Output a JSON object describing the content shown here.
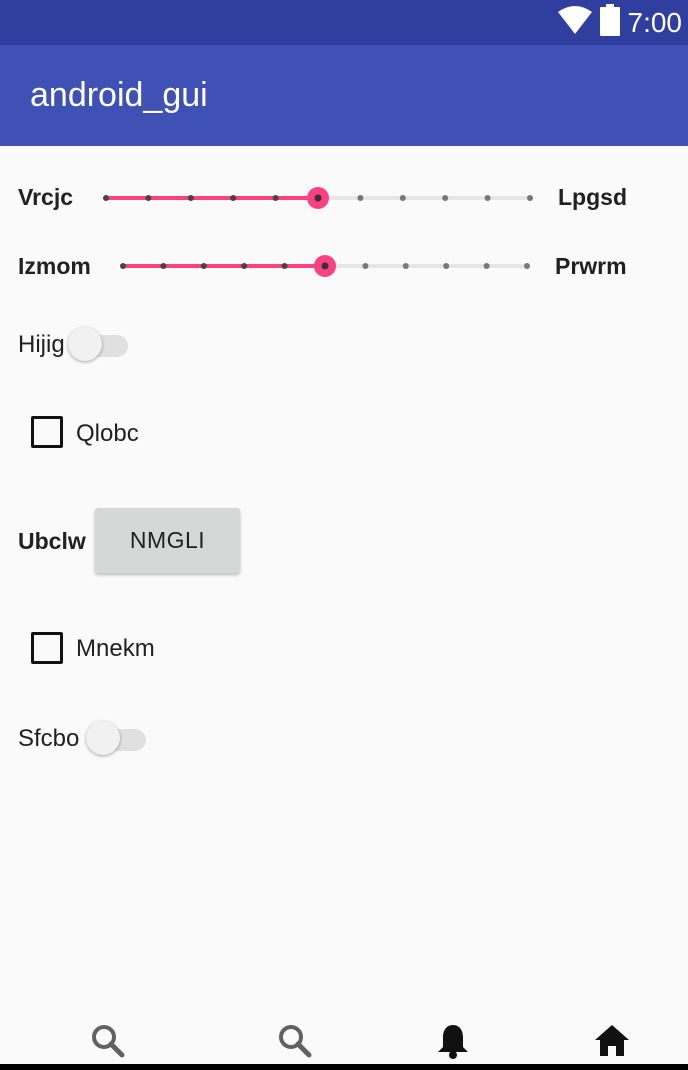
{
  "status_bar": {
    "time": "7:00",
    "icons": [
      "wifi-icon",
      "battery-icon"
    ],
    "color": "#303f9f"
  },
  "app_bar": {
    "title": "android_gui",
    "color": "#3f51b5"
  },
  "accent_color": "#ff4081",
  "sliders": [
    {
      "left_label": "Vrcjc",
      "right_label": "Lpgsd",
      "steps": 10,
      "value": 5
    },
    {
      "left_label": "Izmom",
      "right_label": "Prwrm",
      "steps": 10,
      "value": 5
    }
  ],
  "switch_1": {
    "label": "Hijig",
    "checked": false
  },
  "checkbox_1": {
    "label": "Qlobc",
    "checked": false
  },
  "button_row": {
    "label": "Ubclw",
    "button_text": "NMGLI"
  },
  "checkbox_2": {
    "label": "Mnekm",
    "checked": false
  },
  "switch_2": {
    "label": "Sfcbo",
    "checked": false
  },
  "bottom_nav": {
    "items": [
      {
        "icon": "search-icon"
      },
      {
        "icon": "search-icon"
      },
      {
        "icon": "bell-icon"
      },
      {
        "icon": "home-icon"
      }
    ]
  }
}
